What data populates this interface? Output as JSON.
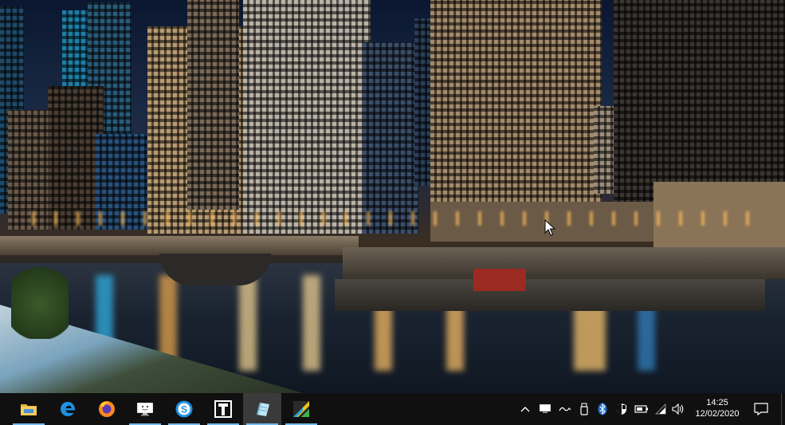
{
  "taskbar": {
    "pinned": [
      {
        "name": "file-explorer",
        "icon": "folder-icon",
        "active": true
      },
      {
        "name": "microsoft-edge",
        "icon": "edge-icon",
        "active": false
      },
      {
        "name": "firefox",
        "icon": "firefox-icon",
        "active": false
      },
      {
        "name": "remote-desktop",
        "icon": "monitor-icon",
        "active": true
      },
      {
        "name": "skype-for-business",
        "icon": "s-icon",
        "active": true
      },
      {
        "name": "typora",
        "icon": "t-icon",
        "active": true
      },
      {
        "name": "notepad-app",
        "icon": "notepad-icon",
        "active": true,
        "selected": true
      },
      {
        "name": "wallpaper-app",
        "icon": "diagonal-icon",
        "active": true
      }
    ],
    "tray": {
      "chevron": "chevron-up-icon",
      "time": "14:25",
      "date": "12/02/2020"
    }
  },
  "colors": {
    "taskbar_bg": "#101010",
    "active_indicator": "#76b9ed"
  }
}
